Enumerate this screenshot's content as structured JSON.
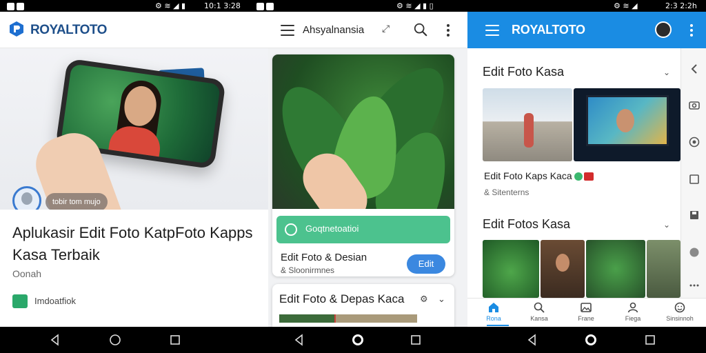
{
  "status_bars": [
    {
      "time": "10:1 3:28"
    },
    {
      "time": ""
    },
    {
      "time": "2:3 2:2h"
    }
  ],
  "pane1": {
    "brand": "ROYALTOTO",
    "hero_chip": "tobir tom mujo",
    "title": "Aplukasir Edit Foto KatpFoto Kapps Kasa Terbaik",
    "subtitle": "Oonah",
    "category": "Imdoatfiok"
  },
  "pane2": {
    "language": "Ahsyalnansia",
    "badge_label": "Goqtnetoatioi",
    "card1": {
      "title": "Edit Foto & Desian",
      "subtitle": "& Sloonirmnes",
      "button": "Edit"
    },
    "card2": {
      "title": "Edit Foto & Depas Kaca"
    }
  },
  "pane3": {
    "brand": "ROYALTOTO",
    "section1": {
      "title": "Edit Foto Kasa",
      "item_title": "Edit Foto Kaps Kaca",
      "item_sub": "& Sitenterns"
    },
    "section2": {
      "title": "Edit Fotos Kasa"
    },
    "tabs": [
      {
        "label": "Rona",
        "icon": "home-icon"
      },
      {
        "label": "Kansa",
        "icon": "search-icon"
      },
      {
        "label": "Frane",
        "icon": "gallery-icon"
      },
      {
        "label": "Fiega",
        "icon": "profile-icon"
      },
      {
        "label": "Sinsinnoh",
        "icon": "emoji-icon"
      }
    ],
    "accent": "#1a8ce3"
  },
  "colors": {
    "brand_blue": "#1e4f8a",
    "green_badge": "#4cc28e",
    "button_blue": "#3b88e0"
  }
}
